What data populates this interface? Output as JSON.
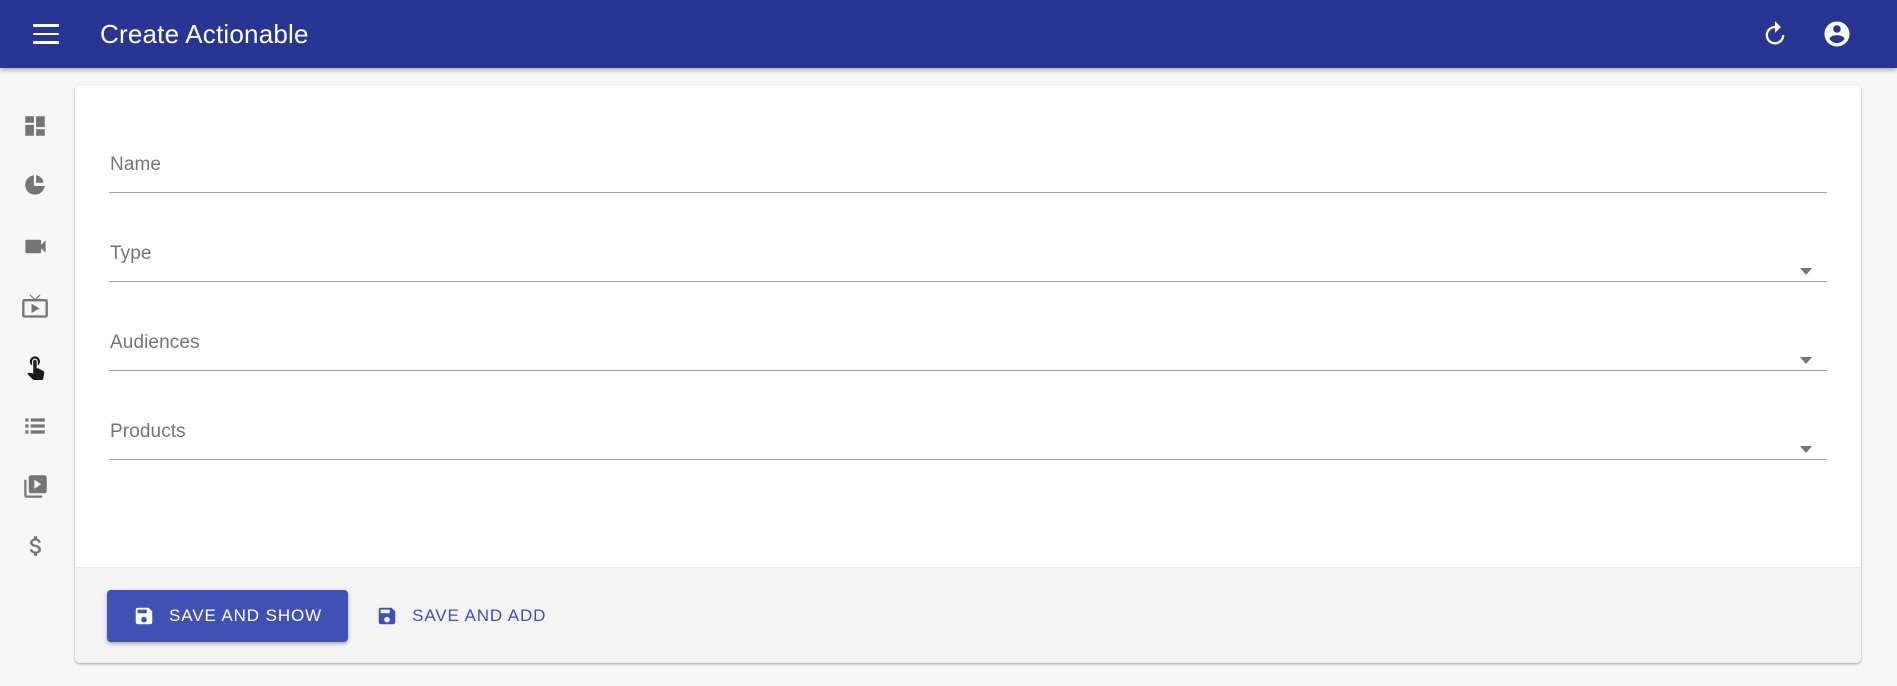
{
  "app": {
    "title": "Create Actionable",
    "header_color": "#283593",
    "accent_color": "#3f51b5",
    "page_background": "#f7f7f7"
  },
  "header": {
    "menu_button": "menu-icon",
    "actions": [
      {
        "name": "refresh-icon",
        "label": "Refresh"
      },
      {
        "name": "account-circle-icon",
        "label": "Account"
      }
    ]
  },
  "sidebar": {
    "items": [
      {
        "name": "sidebar-item-dashboard",
        "icon": "dashboard-icon",
        "active": false
      },
      {
        "name": "sidebar-item-analytics",
        "icon": "pie-chart-icon",
        "active": false
      },
      {
        "name": "sidebar-item-videos",
        "icon": "videocam-icon",
        "active": false
      },
      {
        "name": "sidebar-item-live",
        "icon": "tv-icon",
        "active": false
      },
      {
        "name": "sidebar-item-actionables",
        "icon": "touch-app-icon",
        "active": true
      },
      {
        "name": "sidebar-item-lists",
        "icon": "list-icon",
        "active": false
      },
      {
        "name": "sidebar-item-playlists",
        "icon": "slideshow-icon",
        "active": false
      },
      {
        "name": "sidebar-item-billing",
        "icon": "dollar-icon",
        "active": false
      }
    ]
  },
  "form": {
    "fields": [
      {
        "name": "name-field",
        "label": "Name",
        "value": "",
        "type": "text",
        "has_dropdown": false
      },
      {
        "name": "type-field",
        "label": "Type",
        "value": "",
        "type": "select",
        "has_dropdown": true
      },
      {
        "name": "audiences-field",
        "label": "Audiences",
        "value": "",
        "type": "select",
        "has_dropdown": true
      },
      {
        "name": "products-field",
        "label": "Products",
        "value": "",
        "type": "select",
        "has_dropdown": true
      }
    ]
  },
  "actions": {
    "save_and_show": {
      "label": "SAVE AND SHOW",
      "icon": "save-icon"
    },
    "save_and_add": {
      "label": "SAVE AND ADD",
      "icon": "save-icon"
    }
  }
}
